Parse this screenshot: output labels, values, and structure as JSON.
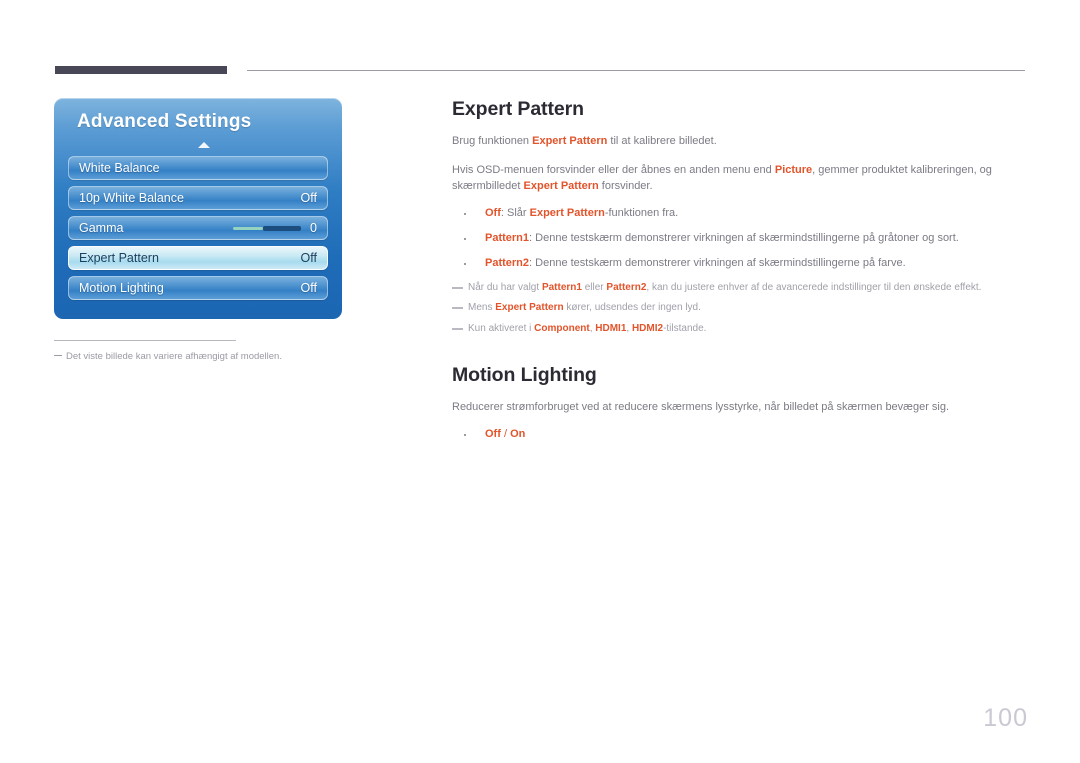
{
  "page": {
    "number": "100"
  },
  "osd": {
    "title": "Advanced Settings",
    "collapse_icon": "triangle-up-icon",
    "panel_color": "#2f7dc3",
    "items": [
      {
        "label": "White Balance",
        "value": "",
        "selected": false,
        "type": "link"
      },
      {
        "label": "10p White Balance",
        "value": "Off",
        "selected": false,
        "type": "value"
      },
      {
        "label": "Gamma",
        "value": "0",
        "selected": false,
        "type": "slider",
        "slider_fill_color": "#94d3c0",
        "slider_track_color": "#1b4e7e"
      },
      {
        "label": "Expert Pattern",
        "value": "Off",
        "selected": true,
        "type": "value"
      },
      {
        "label": "Motion Lighting",
        "value": "Off",
        "selected": false,
        "type": "value"
      }
    ]
  },
  "caption": {
    "text": "Det viste billede kan variere afhængigt af modellen."
  },
  "content": {
    "accent_color": "#e2542b",
    "expert_pattern": {
      "title": "Expert Pattern",
      "intro": {
        "p1_a": "Brug funktionen ",
        "p1_hl": "Expert Pattern",
        "p1_b": " til at kalibrere billedet.",
        "p2_a": "Hvis OSD-menuen forsvinder eller der åbnes en anden menu end ",
        "p2_hl1": "Picture",
        "p2_b": ", gemmer produktet kalibreringen, og skærmbilledet ",
        "p2_hl2": "Expert Pattern",
        "p2_c": " forsvinder."
      },
      "bullets": [
        {
          "hl": "Off",
          "mid": ": Slår ",
          "hl2": "Expert Pattern",
          "tail": "-funktionen fra."
        },
        {
          "hl": "Pattern1",
          "mid": ": Denne testskærm demonstrerer virkningen af skærmindstillingerne på gråtoner og sort.",
          "hl2": "",
          "tail": ""
        },
        {
          "hl": "Pattern2",
          "mid": ": Denne testskærm demonstrerer virkningen af skærmindstillingerne på farve.",
          "hl2": "",
          "tail": ""
        }
      ],
      "notes": [
        {
          "a": "Når du har valgt ",
          "hl1": "Pattern1",
          "b": " eller ",
          "hl2": "Pattern2",
          "c": ", kan du justere enhver af de avancerede indstillinger til den ønskede effekt."
        },
        {
          "a": "Mens ",
          "hl1": "Expert Pattern",
          "b": " kører, udsendes der ingen lyd.",
          "hl2": "",
          "c": ""
        },
        {
          "a": "Kun aktiveret i ",
          "hl1": "Component",
          "b": ", ",
          "hl2": "HDMI1",
          "c": ", ",
          "hl3": "HDMI2",
          "d": "-tilstande."
        }
      ]
    },
    "motion_lighting": {
      "title": "Motion Lighting",
      "intro": "Reducerer strømforbruget ved at reducere skærmens lysstyrke, når billedet på skærmen bevæger sig.",
      "bullet_hl": "Off",
      "bullet_sep": " / ",
      "bullet_hl2": "On"
    }
  }
}
